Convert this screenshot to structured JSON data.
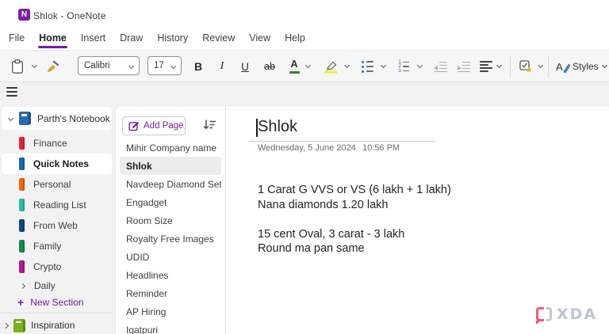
{
  "titlebar": {
    "app_icon_letter": "N",
    "title": "Shlok  -  OneNote"
  },
  "menubar": {
    "items": [
      "File",
      "Home",
      "Insert",
      "Draw",
      "History",
      "Review",
      "View",
      "Help"
    ],
    "active_item": "Home"
  },
  "toolbar": {
    "font_name": "Calibri",
    "font_size": "17",
    "bold_label": "B",
    "italic_label": "I",
    "underline_label": "U",
    "strikethrough_label": "ab",
    "font_color_label": "A",
    "styles_label": "Styles"
  },
  "icons": {
    "plus": "+"
  },
  "sidebar": {
    "notebook_name": "Parth's Notebook",
    "sections": [
      {
        "label": "Finance",
        "color": "#e8213d",
        "selected": false
      },
      {
        "label": "Quick Notes",
        "color": "#2066b2",
        "selected": true
      },
      {
        "label": "Personal",
        "color": "#f7630c",
        "selected": false
      },
      {
        "label": "Reading List",
        "color": "#28bfa6",
        "selected": false
      },
      {
        "label": "From Web",
        "color": "#15477c",
        "selected": false
      },
      {
        "label": "Family",
        "color": "#178a46",
        "selected": false
      },
      {
        "label": "Crypto",
        "color": "#b5178f",
        "selected": false
      }
    ],
    "section_group_label": "Daily",
    "new_section_label": "New Section",
    "other_notebook": {
      "name": "Inspiration",
      "color": "#76b21c"
    }
  },
  "pages": {
    "add_page_label": "Add Page",
    "items": [
      {
        "title": "Mihir Company name",
        "selected": false
      },
      {
        "title": "Shlok",
        "selected": true
      },
      {
        "title": "Navdeep Diamond Set",
        "selected": false
      },
      {
        "title": "Engadget",
        "selected": false
      },
      {
        "title": "Room Size",
        "selected": false
      },
      {
        "title": "Royalty Free Images",
        "selected": false
      },
      {
        "title": "UDID",
        "selected": false
      },
      {
        "title": "Headlines",
        "selected": false
      },
      {
        "title": "Reminder",
        "selected": false
      },
      {
        "title": "AP Hiring",
        "selected": false
      },
      {
        "title": "Igatpuri",
        "selected": false
      }
    ]
  },
  "editor": {
    "page_title": "Shlok",
    "date": "Wednesday, 5 June 2024",
    "time": "10:56 PM",
    "body_lines": [
      "1 Carat G VVS or VS (6 lakh + 1 lakh)",
      "Nana diamonds 1.20 lakh",
      "",
      "15 cent Oval, 3 carat - 3 lakh",
      "Round ma pan same"
    ]
  },
  "watermark": {
    "text": "XDA"
  },
  "colors": {
    "accent_purple": "#7719aa",
    "notebook_icon_blue": "#2569b0",
    "highlight_yellow": "#f7ef1a",
    "font_color_green": "#3e7d34",
    "tag_star_gold": "#f0a30a"
  }
}
